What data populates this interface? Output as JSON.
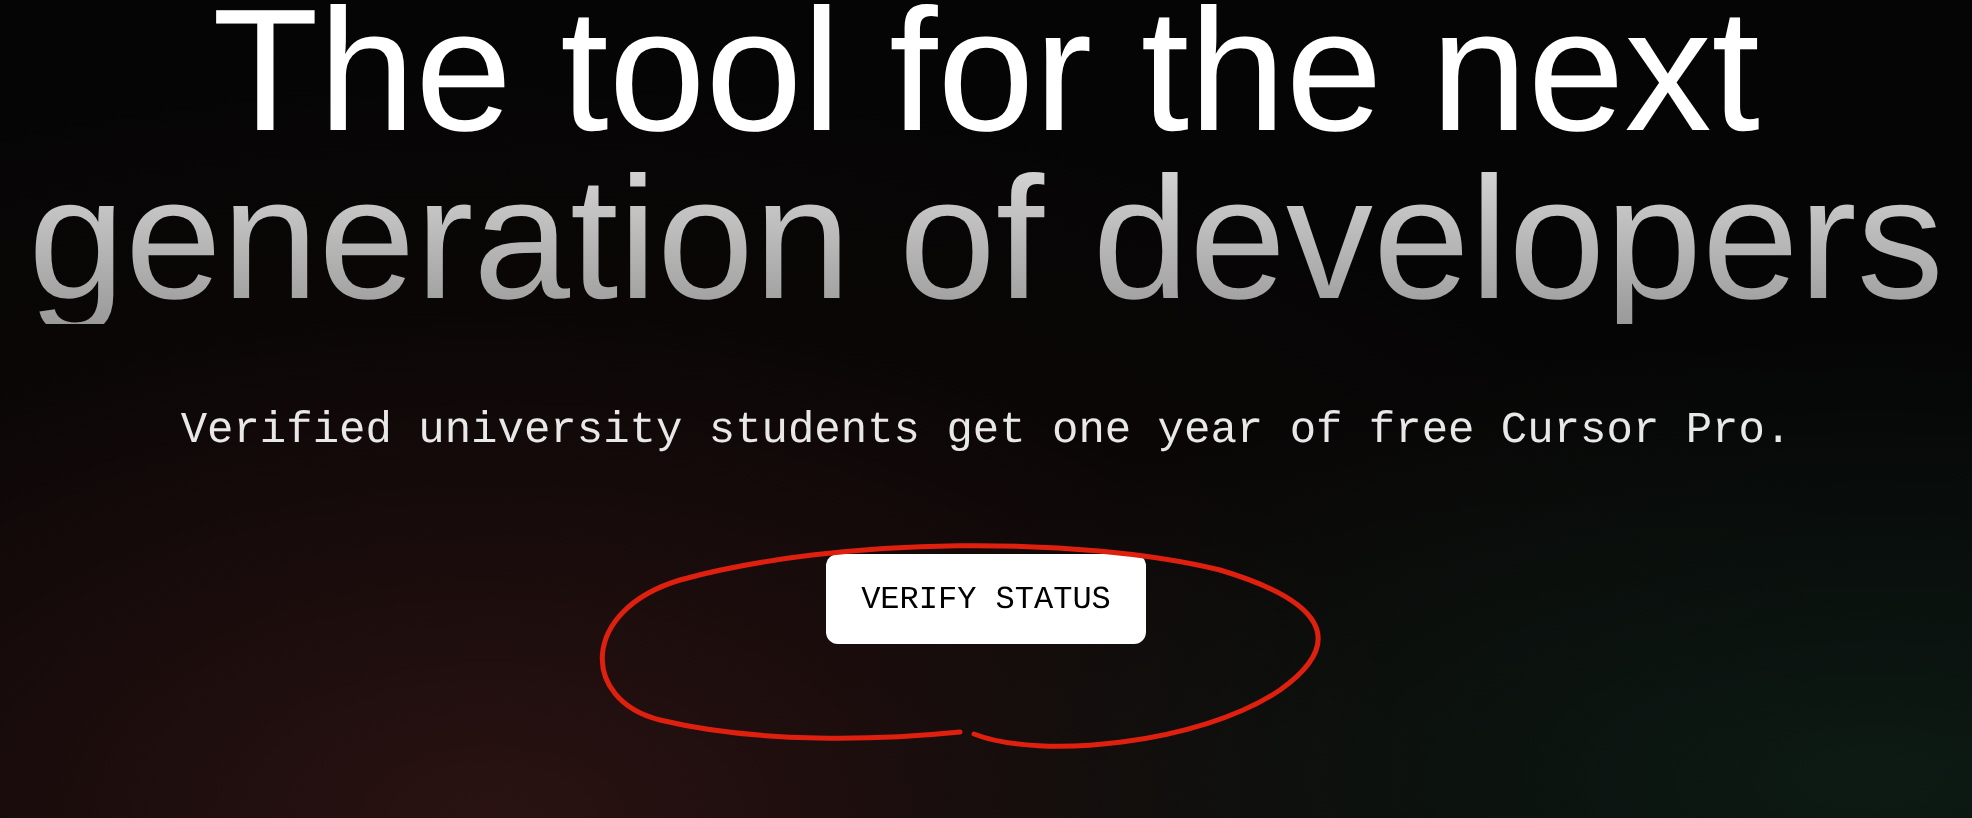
{
  "headline": [
    "The tool for the next",
    "generation of developers"
  ],
  "subtitle": "Verified university students get one year of free Cursor Pro.",
  "button": {
    "label": "VERIFY STATUS"
  }
}
